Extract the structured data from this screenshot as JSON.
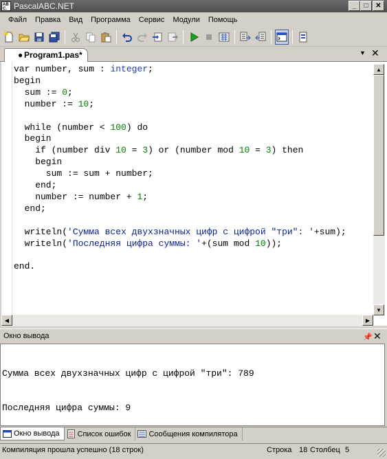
{
  "window": {
    "title": "PascalABC.NET"
  },
  "menu": [
    "Файл",
    "Правка",
    "Вид",
    "Программа",
    "Сервис",
    "Модули",
    "Помощь"
  ],
  "toolbar": {
    "icons": [
      "new-file-icon",
      "open-folder-icon",
      "save-icon",
      "save-all-icon",
      "cut-icon",
      "copy-icon",
      "paste-icon",
      "undo-icon",
      "redo-icon",
      "debug-step-icon",
      "debug-step-over-icon",
      "run-icon",
      "stop-icon",
      "compile-icon",
      "indent-icon",
      "outdent-icon",
      "output-window-icon",
      "properties-icon"
    ]
  },
  "editor": {
    "tab_label": "Program1.pas*",
    "code_lines": [
      [
        [
          "kw",
          "var number, sum : "
        ],
        [
          "tp",
          "integer"
        ],
        [
          "kw",
          ";"
        ]
      ],
      [
        [
          "kw",
          "begin"
        ]
      ],
      [
        [
          "kw",
          "  sum := "
        ],
        [
          "num",
          "0"
        ],
        [
          "kw",
          ";"
        ]
      ],
      [
        [
          "kw",
          "  number := "
        ],
        [
          "num",
          "10"
        ],
        [
          "kw",
          ";"
        ]
      ],
      [
        [
          "kw",
          ""
        ]
      ],
      [
        [
          "kw",
          "  while (number < "
        ],
        [
          "num",
          "100"
        ],
        [
          "kw",
          ") do"
        ]
      ],
      [
        [
          "kw",
          "  begin"
        ]
      ],
      [
        [
          "kw",
          "    if (number div "
        ],
        [
          "num",
          "10"
        ],
        [
          "kw",
          " = "
        ],
        [
          "num",
          "3"
        ],
        [
          "kw",
          ") or (number mod "
        ],
        [
          "num",
          "10"
        ],
        [
          "kw",
          " = "
        ],
        [
          "num",
          "3"
        ],
        [
          "kw",
          ") then"
        ]
      ],
      [
        [
          "kw",
          "    begin"
        ]
      ],
      [
        [
          "kw",
          "      sum := sum + number;"
        ]
      ],
      [
        [
          "kw",
          "    end;"
        ]
      ],
      [
        [
          "kw",
          "    number := number + "
        ],
        [
          "num",
          "1"
        ],
        [
          "kw",
          ";"
        ]
      ],
      [
        [
          "kw",
          "  end;"
        ]
      ],
      [
        [
          "kw",
          ""
        ]
      ],
      [
        [
          "kw",
          "  writeln("
        ],
        [
          "str",
          "'Сумма всех двухзначных цифр с цифрой \"три\": '"
        ],
        [
          "kw",
          "+sum);"
        ]
      ],
      [
        [
          "kw",
          "  writeln("
        ],
        [
          "str",
          "'Последняя цифра суммы: '"
        ],
        [
          "kw",
          "+(sum mod "
        ],
        [
          "num",
          "10"
        ],
        [
          "kw",
          "));"
        ]
      ],
      [
        [
          "kw",
          ""
        ]
      ],
      [
        [
          "kw",
          "end."
        ]
      ]
    ]
  },
  "output": {
    "title": "Окно вывода",
    "lines": [
      "Сумма всех двухзначных цифр с цифрой \"три\": 789",
      "Последняя цифра суммы: 9"
    ]
  },
  "bottom_tabs": [
    "Окно вывода",
    "Список ошибок",
    "Сообщения компилятора"
  ],
  "status": {
    "message": "Компиляция прошла успешно (18 строк)",
    "row_label": "Строка",
    "row_value": "18",
    "col_label": "Столбец",
    "col_value": "5"
  }
}
